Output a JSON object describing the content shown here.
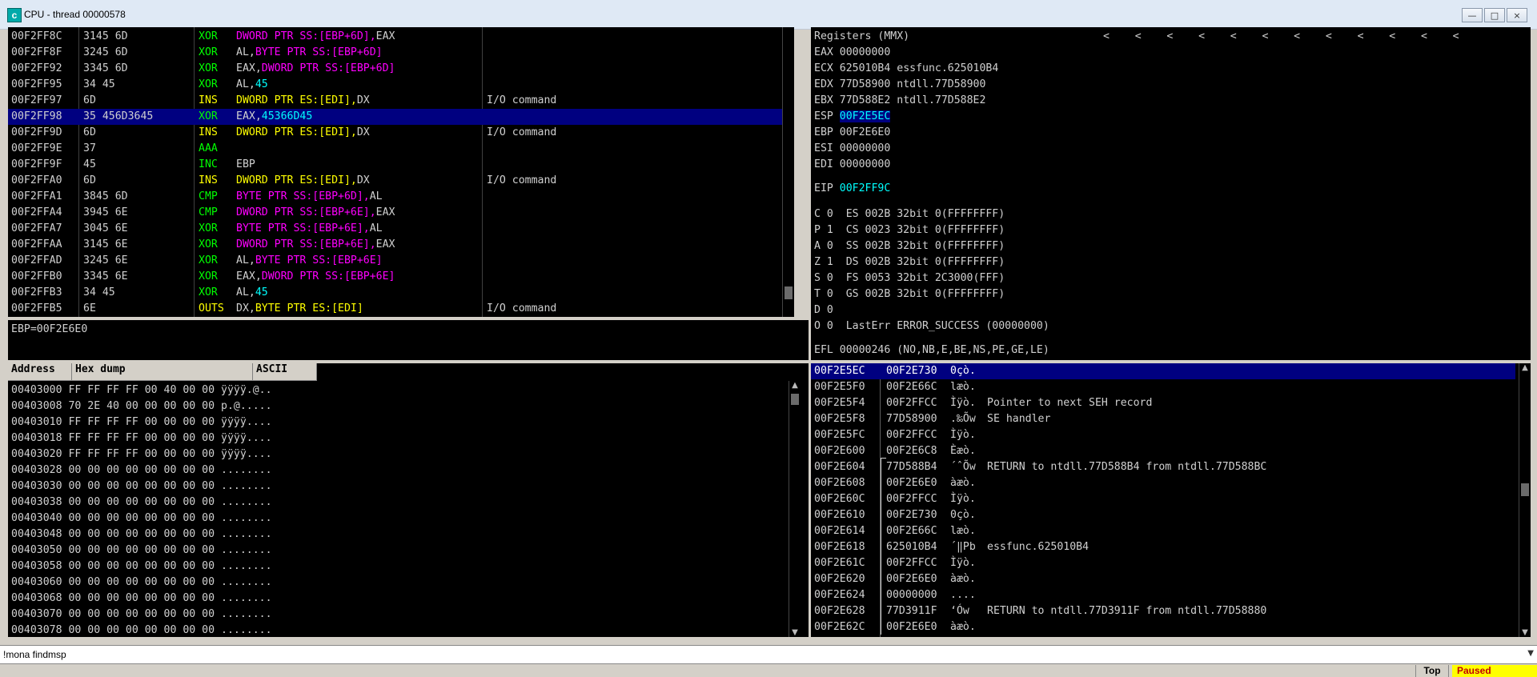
{
  "window": {
    "title": "CPU - thread 00000578",
    "icon_letter": "c"
  },
  "colors": {
    "mnemonic": "#00ff00",
    "operand_mem": "#ff00ff",
    "operand_imm": "#00ffff",
    "io": "#ffff00",
    "register_hl": "#00ffff",
    "selection": "#000080"
  },
  "disasm": {
    "rows": [
      {
        "addr": "00F2FF8C",
        "hex": "3145 6D",
        "mn": "XOR",
        "op": "DWORD PTR SS:[EBP+6D],EAX",
        "kind": "mem",
        "cm": ""
      },
      {
        "addr": "00F2FF8F",
        "hex": "3245 6D",
        "mn": "XOR",
        "op": "AL,BYTE PTR SS:[EBP+6D]",
        "kind": "mem",
        "cm": ""
      },
      {
        "addr": "00F2FF92",
        "hex": "3345 6D",
        "mn": "XOR",
        "op": "EAX,DWORD PTR SS:[EBP+6D]",
        "kind": "mem",
        "cm": ""
      },
      {
        "addr": "00F2FF95",
        "hex": "34 45",
        "mn": "XOR",
        "op": "AL,45",
        "kind": "imm",
        "cm": ""
      },
      {
        "addr": "00F2FF97",
        "hex": "6D",
        "mn": "INS",
        "op": "DWORD PTR ES:[EDI],DX",
        "kind": "io",
        "cm": "I/O command"
      },
      {
        "addr": "00F2FF98",
        "hex": "35 456D3645",
        "mn": "XOR",
        "op": "EAX,45366D45",
        "kind": "imm",
        "cm": "",
        "selected": true
      },
      {
        "addr": "00F2FF9D",
        "hex": "6D",
        "mn": "INS",
        "op": "DWORD PTR ES:[EDI],DX",
        "kind": "io",
        "cm": "I/O command"
      },
      {
        "addr": "00F2FF9E",
        "hex": "37",
        "mn": "AAA",
        "op": "",
        "kind": "plain",
        "cm": ""
      },
      {
        "addr": "00F2FF9F",
        "hex": "45",
        "mn": "INC",
        "op": "EBP",
        "kind": "plain",
        "cm": ""
      },
      {
        "addr": "00F2FFA0",
        "hex": "6D",
        "mn": "INS",
        "op": "DWORD PTR ES:[EDI],DX",
        "kind": "io",
        "cm": "I/O command"
      },
      {
        "addr": "00F2FFA1",
        "hex": "3845 6D",
        "mn": "CMP",
        "op": "BYTE PTR SS:[EBP+6D],AL",
        "kind": "mem",
        "cm": ""
      },
      {
        "addr": "00F2FFA4",
        "hex": "3945 6E",
        "mn": "CMP",
        "op": "DWORD PTR SS:[EBP+6E],EAX",
        "kind": "mem",
        "cm": ""
      },
      {
        "addr": "00F2FFA7",
        "hex": "3045 6E",
        "mn": "XOR",
        "op": "BYTE PTR SS:[EBP+6E],AL",
        "kind": "mem",
        "cm": ""
      },
      {
        "addr": "00F2FFAA",
        "hex": "3145 6E",
        "mn": "XOR",
        "op": "DWORD PTR SS:[EBP+6E],EAX",
        "kind": "mem",
        "cm": ""
      },
      {
        "addr": "00F2FFAD",
        "hex": "3245 6E",
        "mn": "XOR",
        "op": "AL,BYTE PTR SS:[EBP+6E]",
        "kind": "mem",
        "cm": ""
      },
      {
        "addr": "00F2FFB0",
        "hex": "3345 6E",
        "mn": "XOR",
        "op": "EAX,DWORD PTR SS:[EBP+6E]",
        "kind": "mem",
        "cm": ""
      },
      {
        "addr": "00F2FFB3",
        "hex": "34 45",
        "mn": "XOR",
        "op": "AL,45",
        "kind": "imm",
        "cm": ""
      },
      {
        "addr": "00F2FFB5",
        "hex": "6E",
        "mn": "OUTS",
        "op": "DX,BYTE PTR ES:[EDI]",
        "kind": "io",
        "cm": "I/O command"
      }
    ]
  },
  "info": {
    "text": "EBP=00F2E6E0"
  },
  "registers": {
    "header": "Registers (MMX)",
    "arrows": "<    <    <    <    <    <    <    <    <    <    <    <",
    "gp": [
      {
        "name": "EAX",
        "val": "00000000",
        "note": ""
      },
      {
        "name": "ECX",
        "val": "625010B4",
        "note": "essfunc.625010B4"
      },
      {
        "name": "EDX",
        "val": "77D58900",
        "note": "ntdll.77D58900"
      },
      {
        "name": "EBX",
        "val": "77D588E2",
        "note": "ntdll.77D588E2"
      },
      {
        "name": "ESP",
        "val": "00F2E5EC",
        "note": "",
        "hl": true
      },
      {
        "name": "EBP",
        "val": "00F2E6E0",
        "note": ""
      },
      {
        "name": "ESI",
        "val": "00000000",
        "note": ""
      },
      {
        "name": "EDI",
        "val": "00000000",
        "note": ""
      }
    ],
    "eip": {
      "name": "EIP",
      "val": "00F2FF9C"
    },
    "flags": [
      "C 0  ES 002B 32bit 0(FFFFFFFF)",
      "P 1  CS 0023 32bit 0(FFFFFFFF)",
      "A 0  SS 002B 32bit 0(FFFFFFFF)",
      "Z 1  DS 002B 32bit 0(FFFFFFFF)",
      "S 0  FS 0053 32bit 2C3000(FFF)",
      "T 0  GS 002B 32bit 0(FFFFFFFF)",
      "D 0",
      "O 0  LastErr ERROR_SUCCESS (00000000)"
    ],
    "efl": "EFL 00000246 (NO,NB,E,BE,NS,PE,GE,LE)"
  },
  "dump": {
    "headers": [
      "Address",
      "Hex dump",
      "ASCII"
    ],
    "rows": [
      "00403000 FF FF FF FF 00 40 00 00 ÿÿÿÿ.@..",
      "00403008 70 2E 40 00 00 00 00 00 p.@.....",
      "00403010 FF FF FF FF 00 00 00 00 ÿÿÿÿ....",
      "00403018 FF FF FF FF 00 00 00 00 ÿÿÿÿ....",
      "00403020 FF FF FF FF 00 00 00 00 ÿÿÿÿ....",
      "00403028 00 00 00 00 00 00 00 00 ........",
      "00403030 00 00 00 00 00 00 00 00 ........",
      "00403038 00 00 00 00 00 00 00 00 ........",
      "00403040 00 00 00 00 00 00 00 00 ........",
      "00403048 00 00 00 00 00 00 00 00 ........",
      "00403050 00 00 00 00 00 00 00 00 ........",
      "00403058 00 00 00 00 00 00 00 00 ........",
      "00403060 00 00 00 00 00 00 00 00 ........",
      "00403068 00 00 00 00 00 00 00 00 ........",
      "00403070 00 00 00 00 00 00 00 00 ........",
      "00403078 00 00 00 00 00 00 00 00 ........"
    ]
  },
  "stack": {
    "rows": [
      {
        "addr": "00F2E5EC",
        "val": "00F2E730",
        "asc": "0çò.",
        "cm": "",
        "selected": true
      },
      {
        "addr": "00F2E5F0",
        "val": "00F2E66C",
        "asc": "læò.",
        "cm": ""
      },
      {
        "addr": "00F2E5F4",
        "val": "00F2FFCC",
        "asc": "Ìÿò.",
        "cm": "Pointer to next SEH record"
      },
      {
        "addr": "00F2E5F8",
        "val": "77D58900",
        "asc": ".‰Õw",
        "cm": "SE handler"
      },
      {
        "addr": "00F2E5FC",
        "val": "00F2FFCC",
        "asc": "Ìÿò.",
        "cm": ""
      },
      {
        "addr": "00F2E600",
        "val": "00F2E6C8",
        "asc": "Èæò.",
        "cm": ""
      },
      {
        "addr": "00F2E604",
        "val": "77D588B4",
        "asc": "´ˆÕw",
        "cm": "RETURN to ntdll.77D588B4 from ntdll.77D588BC"
      },
      {
        "addr": "00F2E608",
        "val": "00F2E6E0",
        "asc": "àæò.",
        "cm": ""
      },
      {
        "addr": "00F2E60C",
        "val": "00F2FFCC",
        "asc": "Ìÿò.",
        "cm": ""
      },
      {
        "addr": "00F2E610",
        "val": "00F2E730",
        "asc": "0çò.",
        "cm": ""
      },
      {
        "addr": "00F2E614",
        "val": "00F2E66C",
        "asc": "læò.",
        "cm": ""
      },
      {
        "addr": "00F2E618",
        "val": "625010B4",
        "asc": "´‖Pb",
        "cm": "essfunc.625010B4"
      },
      {
        "addr": "00F2E61C",
        "val": "00F2FFCC",
        "asc": "Ìÿò.",
        "cm": ""
      },
      {
        "addr": "00F2E620",
        "val": "00F2E6E0",
        "asc": "àæò.",
        "cm": ""
      },
      {
        "addr": "00F2E624",
        "val": "00000000",
        "asc": "....",
        "cm": ""
      },
      {
        "addr": "00F2E628",
        "val": "77D3911F",
        "asc": "‘Ów",
        "cm": "RETURN to ntdll.77D3911F from ntdll.77D58880"
      },
      {
        "addr": "00F2E62C",
        "val": "00F2E6E0",
        "asc": "àæò.",
        "cm": ""
      }
    ]
  },
  "command": {
    "value": "!mona findmsp"
  },
  "status": {
    "top_label": "Top",
    "state": "Paused"
  }
}
